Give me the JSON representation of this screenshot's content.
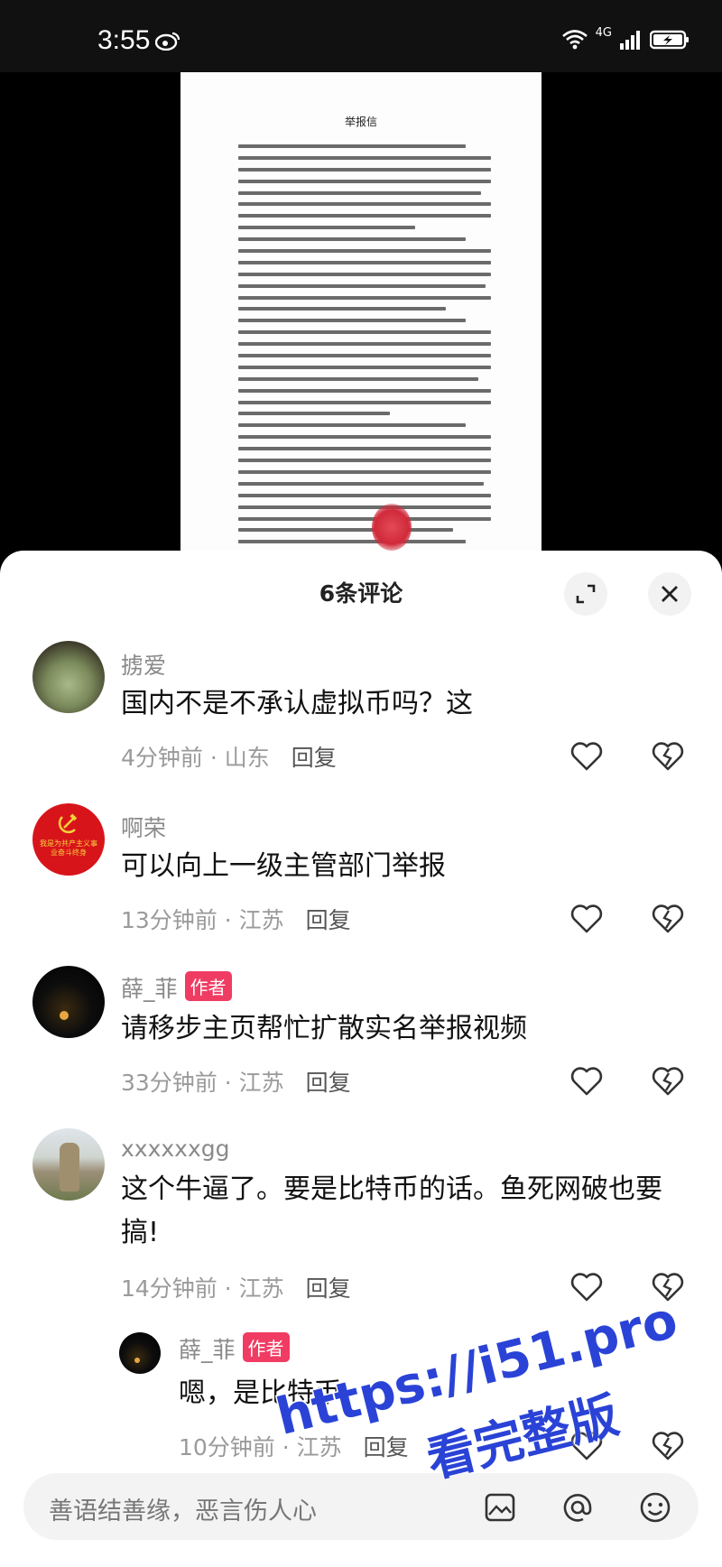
{
  "status_bar": {
    "time": "3:55",
    "network": "4G"
  },
  "document": {
    "title": "举报信",
    "line_count": 46
  },
  "sheet": {
    "title": "6条评论"
  },
  "comments": [
    {
      "user": "掳爱",
      "text": "国内不是不承认虚拟币吗？这",
      "time": "4分钟前 · 山东",
      "reply": "回复",
      "is_author": false
    },
    {
      "user": "啊荣",
      "text": "可以向上一级主管部门举报",
      "time": "13分钟前 · 江苏",
      "reply": "回复",
      "is_author": false,
      "avatar_text": "我是为共产主义事业奋斗终身"
    },
    {
      "user": "薛_菲",
      "badge": "作者",
      "text": "请移步主页帮忙扩散实名举报视频",
      "time": "33分钟前 · 江苏",
      "reply": "回复",
      "is_author": true
    },
    {
      "user": "xxxxxxgg",
      "text": "这个牛逼了。要是比特币的话。鱼死网破也要搞!",
      "time": "14分钟前 · 江苏",
      "reply": "回复",
      "is_author": false
    },
    {
      "user": "薛_菲",
      "badge": "作者",
      "text": "嗯，是比特币，",
      "time": "10分钟前 · 江苏",
      "reply": "回复",
      "is_author": true,
      "is_reply": true
    }
  ],
  "watermark": {
    "line1": "https://i51.pro",
    "line2": "看完整版"
  },
  "input": {
    "placeholder": "善语结善缘，恶言伤人心"
  },
  "colors": {
    "author_badge": "#f03c63",
    "watermark": "#2a43d6",
    "stamp": "#d02a3a"
  }
}
